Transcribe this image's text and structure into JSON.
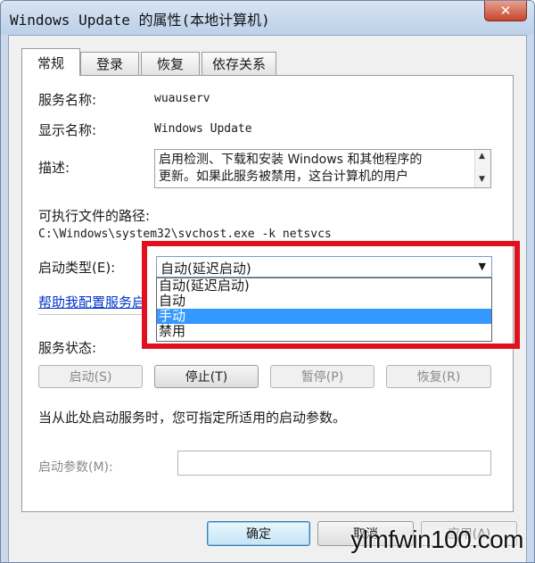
{
  "window": {
    "title": "Windows Update 的属性(本地计算机)",
    "close_glyph": "✕"
  },
  "tabs": [
    {
      "label": "常规",
      "active": true
    },
    {
      "label": "登录",
      "active": false
    },
    {
      "label": "恢复",
      "active": false
    },
    {
      "label": "依存关系",
      "active": false
    }
  ],
  "general": {
    "service_name_label": "服务名称:",
    "service_name_value": "wuauserv",
    "display_name_label": "显示名称:",
    "display_name_value": "Windows Update",
    "description_label": "描述:",
    "description_text": "启用检测、下载和安装 Windows 和其他程序的\n更新。如果此服务被禁用，这台计算机的用户",
    "path_label": "可执行文件的路径:",
    "path_value": "C:\\Windows\\system32\\svchost.exe -k netsvcs",
    "startup_type_label": "启动类型(E):",
    "startup_type_value": "自动(延迟启动)",
    "startup_options": [
      "自动(延迟启动)",
      "自动",
      "手动",
      "禁用"
    ],
    "startup_highlighted": "手动",
    "help_link": "帮助我配置服务启",
    "status_label": "服务状态:",
    "buttons": {
      "start": "启动(S)",
      "stop": "停止(T)",
      "pause": "暂停(P)",
      "resume": "恢复(R)"
    },
    "hint_text": "当从此处启动服务时，您可指定所适用的启动参数。",
    "params_label": "启动参数(M):",
    "params_value": ""
  },
  "footer": {
    "ok": "确定",
    "cancel": "取消",
    "apply": "应用(A)"
  },
  "watermark": "ylmfwin100.com",
  "colors": {
    "highlight": "#3399ff",
    "annotation_frame": "#e0101e",
    "link": "#0033cc"
  }
}
